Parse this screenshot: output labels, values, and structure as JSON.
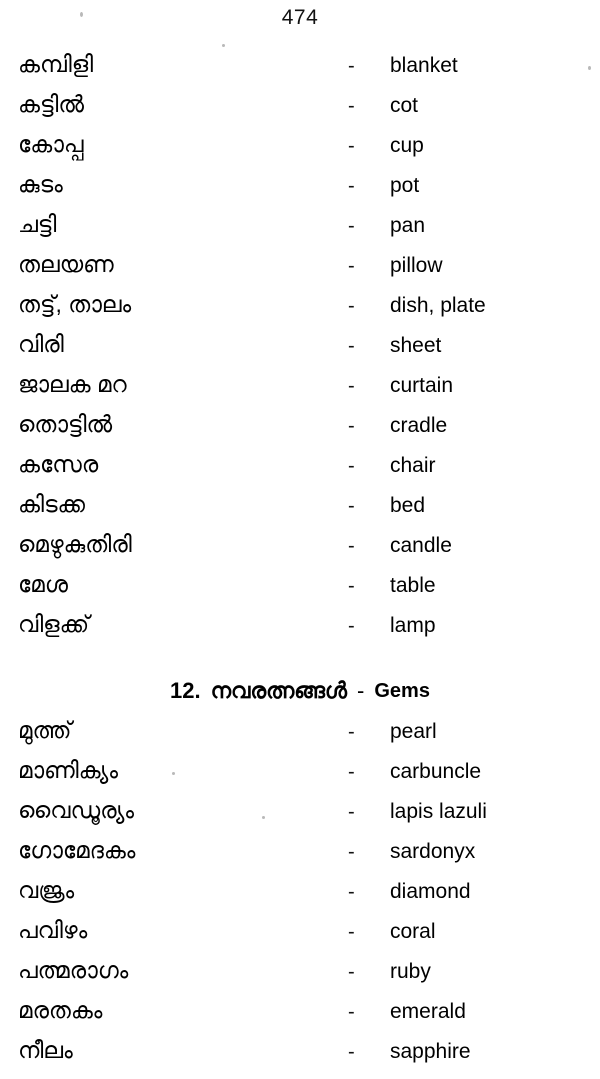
{
  "page": {
    "number": "474"
  },
  "household_section": {
    "entries": [
      {
        "term": "കമ്പിളി",
        "dash": "-",
        "gloss": "blanket"
      },
      {
        "term": "കട്ടിൽ",
        "dash": "-",
        "gloss": "cot"
      },
      {
        "term": "കോപ്പ",
        "dash": "-",
        "gloss": "cup"
      },
      {
        "term": "കുടം",
        "dash": "-",
        "gloss": "pot"
      },
      {
        "term": "ചട്ടി",
        "dash": "-",
        "gloss": "pan"
      },
      {
        "term": "തലയണ",
        "dash": "-",
        "gloss": "pillow"
      },
      {
        "term": "തട്ട്, താലം",
        "dash": "-",
        "gloss": "dish, plate"
      },
      {
        "term": "വിരി",
        "dash": "-",
        "gloss": "sheet"
      },
      {
        "term": "ജാലക മറ",
        "dash": "-",
        "gloss": "curtain"
      },
      {
        "term": "തൊട്ടിൽ",
        "dash": "-",
        "gloss": "cradle"
      },
      {
        "term": "കസേര",
        "dash": "-",
        "gloss": "chair"
      },
      {
        "term": "കിടക്ക",
        "dash": "-",
        "gloss": "bed"
      },
      {
        "term": "മെഴുകുതിരി",
        "dash": "-",
        "gloss": "candle"
      },
      {
        "term": "മേശ",
        "dash": "-",
        "gloss": "table"
      },
      {
        "term": "വിളക്ക്",
        "dash": "-",
        "gloss": "lamp"
      }
    ]
  },
  "gems_section": {
    "heading": {
      "number": "12.",
      "title_ml": "നവരത്നങ്ങൾ",
      "separator": "-",
      "title_en": "Gems"
    },
    "entries": [
      {
        "term": "മുത്ത്",
        "dash": "-",
        "gloss": "pearl"
      },
      {
        "term": "മാണിക്യം",
        "dash": "-",
        "gloss": "carbuncle"
      },
      {
        "term": "വൈഡൂര്യം",
        "dash": "-",
        "gloss": "lapis lazuli"
      },
      {
        "term": "ഗോമേദകം",
        "dash": "-",
        "gloss": "sardonyx"
      },
      {
        "term": "വജ്രം",
        "dash": "-",
        "gloss": "diamond"
      },
      {
        "term": "പവിഴം",
        "dash": "-",
        "gloss": "coral"
      },
      {
        "term": "പത്മരാഗം",
        "dash": "-",
        "gloss": "ruby"
      },
      {
        "term": "മരതകം",
        "dash": "-",
        "gloss": "emerald"
      },
      {
        "term": "നീലം",
        "dash": "-",
        "gloss": "sapphire"
      }
    ]
  }
}
